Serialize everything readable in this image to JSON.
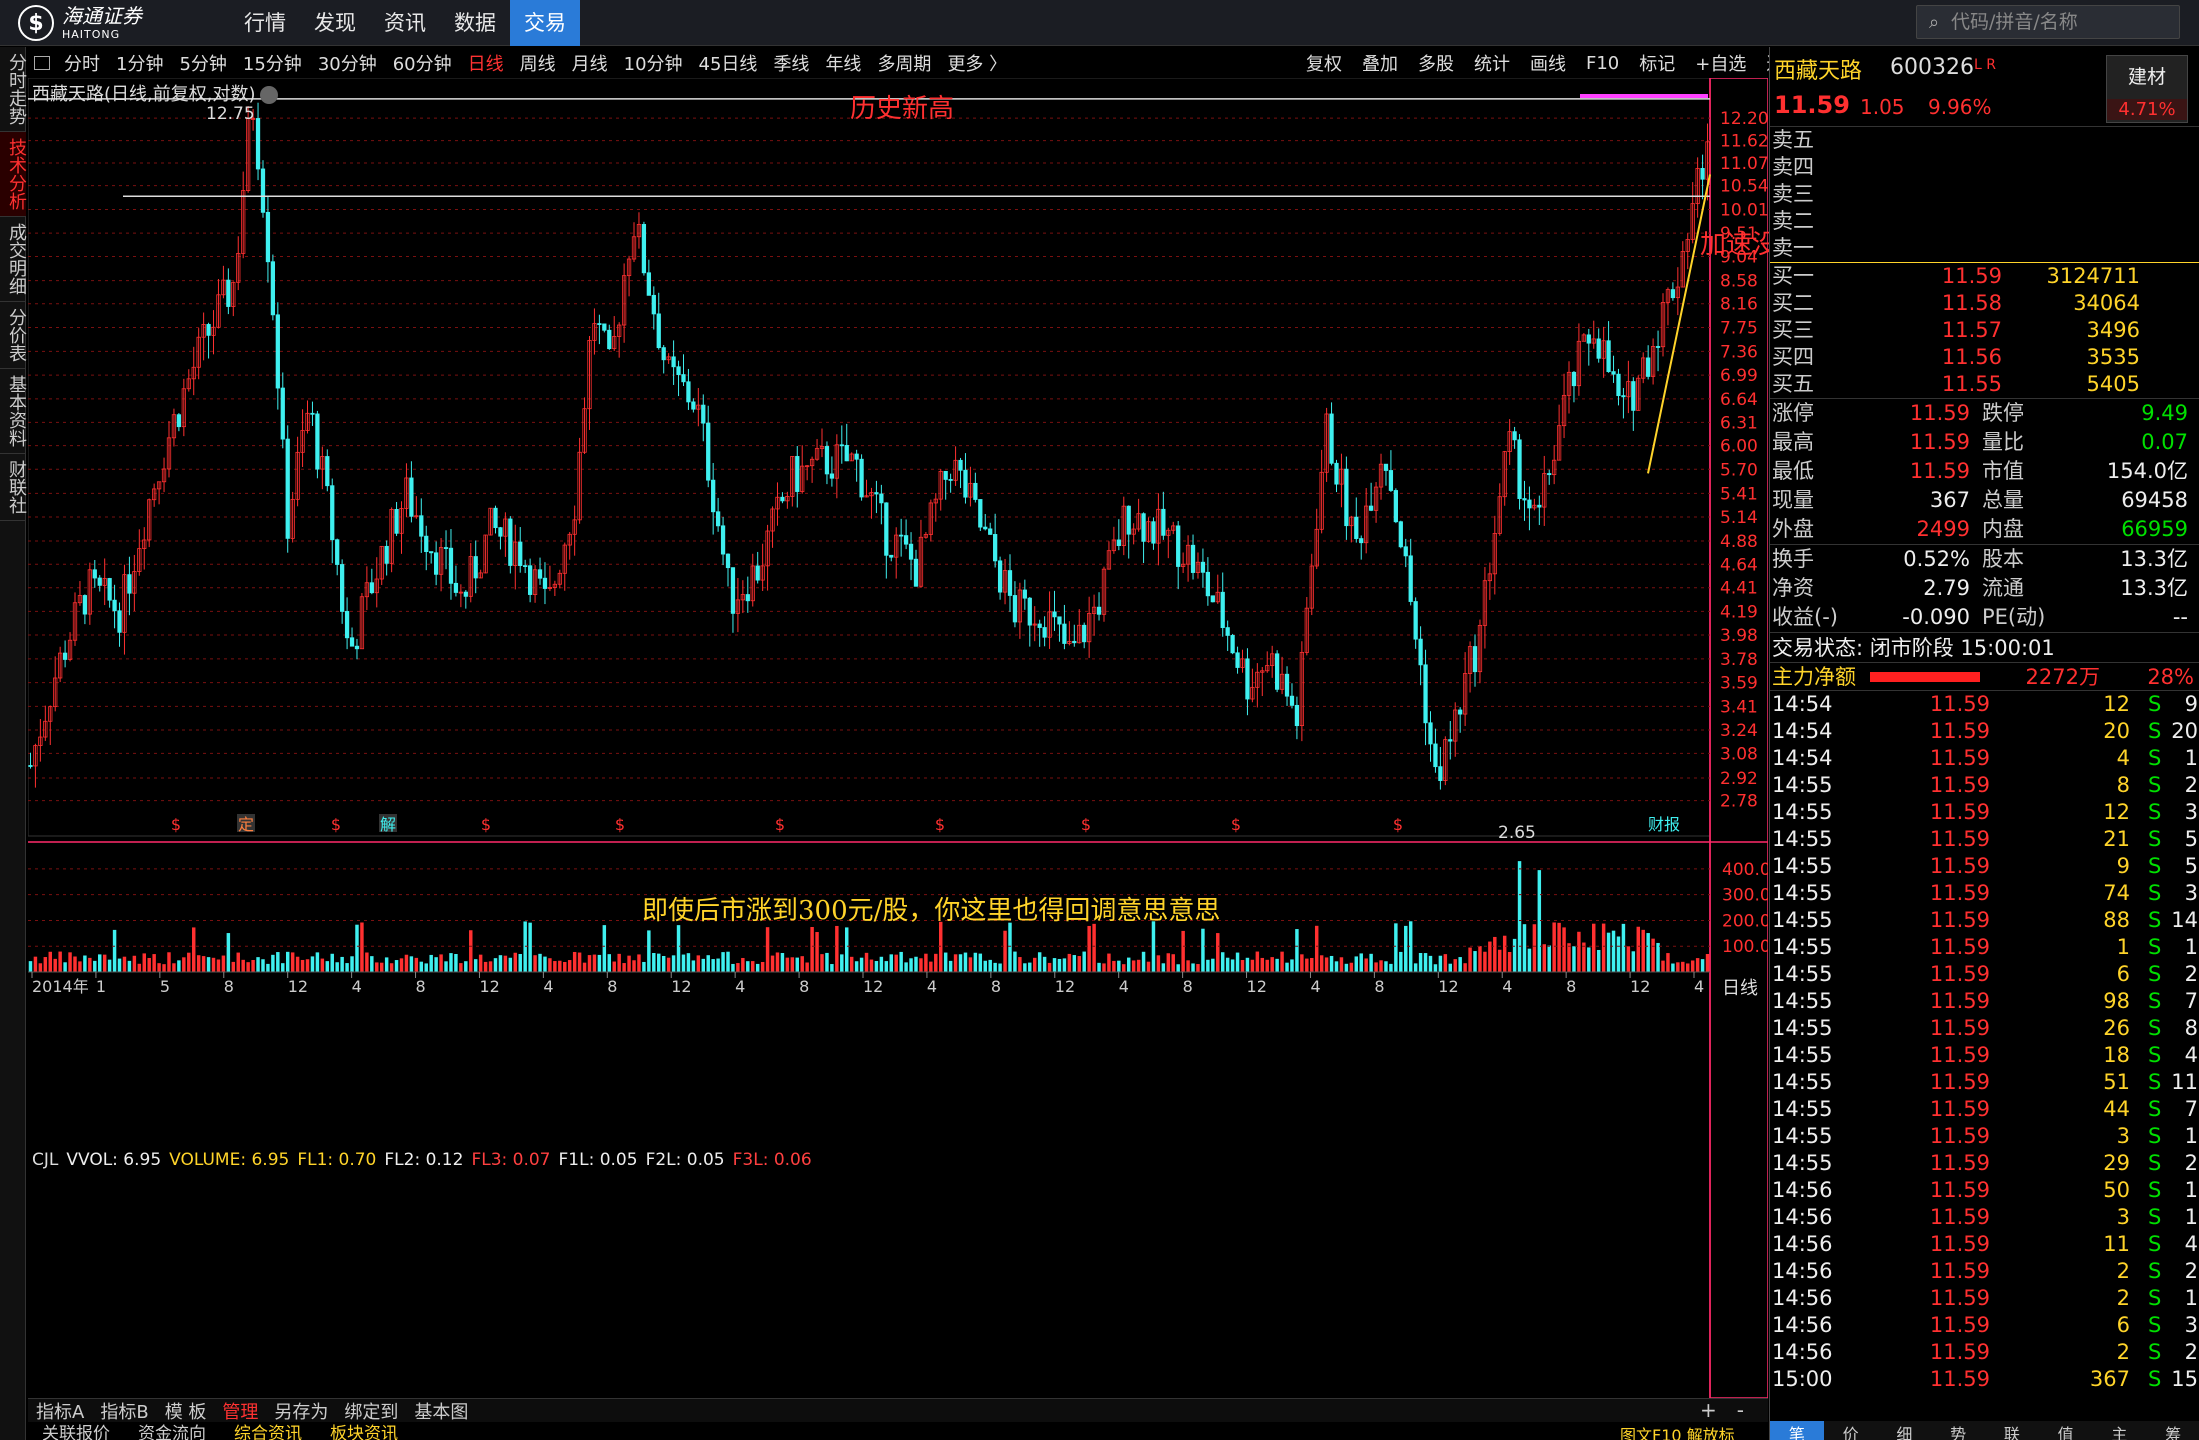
{
  "brand": {
    "cn": "海通证券",
    "en": "HAITONG"
  },
  "nav": [
    "行情",
    "发现",
    "资讯",
    "数据",
    "交易"
  ],
  "nav_active": 4,
  "search": {
    "placeholder": "代码/拼音/名称"
  },
  "left_tabs": [
    "分时走势",
    "技术分析",
    "成交明细",
    "分价表",
    "基本资料",
    "财联社"
  ],
  "left_tab_active": 1,
  "periods": [
    "分时",
    "1分钟",
    "5分钟",
    "15分钟",
    "30分钟",
    "60分钟",
    "日线",
    "周线",
    "月线",
    "10分钟",
    "45日线",
    "季线",
    "年线",
    "多周期",
    "更多 〉"
  ],
  "period_active": 6,
  "toolbar_right": [
    "复权",
    "叠加",
    "多股",
    "统计",
    "画线",
    "F10",
    "标记",
    "+自选",
    "返回"
  ],
  "chart": {
    "title": "西藏天路(日线,前复权,对数)",
    "annotation_high": "历史新高",
    "annotation_accel": "加速没有？",
    "annotation_mid": "即使后市涨到300元/股，你这里也得回调意思意思",
    "high_label": "12.75",
    "low_label": "2.65",
    "price_axis": [
      "12.20",
      "11.62",
      "11.07",
      "10.54",
      "10.01",
      "9.51",
      "9.04",
      "8.58",
      "8.16",
      "7.75",
      "7.36",
      "6.99",
      "6.64",
      "6.31",
      "6.00",
      "5.70",
      "5.41",
      "5.14",
      "4.88",
      "4.64",
      "4.41",
      "4.19",
      "3.98",
      "3.78",
      "3.59",
      "3.41",
      "3.24",
      "3.08",
      "2.92",
      "2.78"
    ],
    "x_axis": [
      "2014年",
      "1",
      "5",
      "8",
      "12",
      "4",
      "8",
      "12",
      "4",
      "8",
      "12",
      "4",
      "8",
      "12",
      "4",
      "8",
      "12",
      "4",
      "8",
      "12",
      "4",
      "8",
      "12",
      "4",
      "8",
      "12",
      "4"
    ],
    "event_markers": [
      "$",
      "定",
      "$",
      "解",
      "$",
      "$",
      "$",
      "$",
      "$",
      "$",
      "$"
    ],
    "event_tag_right": "财报",
    "period_tag": "日线"
  },
  "volume": {
    "legend": [
      {
        "k": "CJL",
        "c": "#dddddd"
      },
      {
        "k": "VVOL: 6.95",
        "c": "#eeeeee"
      },
      {
        "k": "VOLUME: 6.95",
        "c": "#ffd42a"
      },
      {
        "k": "FL1: 0.70",
        "c": "#ffd42a"
      },
      {
        "k": "FL2: 0.12",
        "c": "#eeeeee"
      },
      {
        "k": "FL3: 0.07",
        "c": "#ff4040"
      },
      {
        "k": "F1L: 0.05",
        "c": "#eeeeee"
      },
      {
        "k": "F2L: 0.05",
        "c": "#eeeeee"
      },
      {
        "k": "F3L: 0.06",
        "c": "#ff4040"
      }
    ],
    "axis": [
      "400.0",
      "300.0",
      "200.0",
      "100.0"
    ]
  },
  "bottom_tabs": [
    "指标A",
    "指标B",
    "模 板",
    "管理",
    "另存为",
    "绑定到",
    "基本图"
  ],
  "bottom_tab_active": 3,
  "bottom_tabs2": [
    "关联报价",
    "资金流向",
    "综合资讯",
    "板块资讯"
  ],
  "bottom_right": "图文F10 解放标",
  "zoom": [
    "+",
    "-"
  ],
  "stock": {
    "name": "西藏天路",
    "code": "600326",
    "flags": "L R",
    "price": "11.59",
    "change": "1.05",
    "pct": "9.96%",
    "industry": "建材",
    "industry_pct": "4.71%"
  },
  "asks": [
    {
      "l": "卖五",
      "p": "",
      "v": ""
    },
    {
      "l": "卖四",
      "p": "",
      "v": ""
    },
    {
      "l": "卖三",
      "p": "",
      "v": ""
    },
    {
      "l": "卖二",
      "p": "",
      "v": ""
    },
    {
      "l": "卖一",
      "p": "",
      "v": ""
    }
  ],
  "bids": [
    {
      "l": "买一",
      "p": "11.59",
      "v": "3124711"
    },
    {
      "l": "买二",
      "p": "11.58",
      "v": "34064"
    },
    {
      "l": "买三",
      "p": "11.57",
      "v": "3496"
    },
    {
      "l": "买四",
      "p": "11.56",
      "v": "3535"
    },
    {
      "l": "买五",
      "p": "11.55",
      "v": "5405"
    }
  ],
  "stats": [
    {
      "l1": "涨停",
      "v1": "11.59",
      "c1": "red",
      "l2": "跌停",
      "v2": "9.49",
      "c2": "grn"
    },
    {
      "l1": "最高",
      "v1": "11.59",
      "c1": "red",
      "l2": "量比",
      "v2": "0.07",
      "c2": "grn"
    },
    {
      "l1": "最低",
      "v1": "11.59",
      "c1": "red",
      "l2": "市值",
      "v2": "154.0亿",
      "c2": "wht"
    },
    {
      "l1": "现量",
      "v1": "367",
      "c1": "wht",
      "l2": "总量",
      "v2": "69458",
      "c2": "wht"
    },
    {
      "l1": "外盘",
      "v1": "2499",
      "c1": "red",
      "l2": "内盘",
      "v2": "66959",
      "c2": "grn"
    }
  ],
  "stats2": [
    {
      "l1": "换手",
      "v1": "0.52%",
      "c1": "wht",
      "l2": "股本",
      "v2": "13.3亿",
      "c2": "wht"
    },
    {
      "l1": "净资",
      "v1": "2.79",
      "c1": "wht",
      "l2": "流通",
      "v2": "13.3亿",
      "c2": "wht"
    },
    {
      "l1": "收益(-)",
      "v1": "-0.090",
      "c1": "wht",
      "l2": "PE(动)",
      "v2": "--",
      "c2": "wht"
    }
  ],
  "trade_state": "交易状态: 闭市阶段 15:00:01",
  "main_flow": {
    "label": "主力净额",
    "amount": "2272万",
    "pct": "28%"
  },
  "ticks": [
    {
      "t": "14:54",
      "p": "11.59",
      "v": "12",
      "n": "9"
    },
    {
      "t": "14:54",
      "p": "11.59",
      "v": "20",
      "n": "20"
    },
    {
      "t": "14:54",
      "p": "11.59",
      "v": "4",
      "n": "1"
    },
    {
      "t": "14:55",
      "p": "11.59",
      "v": "8",
      "n": "2"
    },
    {
      "t": "14:55",
      "p": "11.59",
      "v": "12",
      "n": "3"
    },
    {
      "t": "14:55",
      "p": "11.59",
      "v": "21",
      "n": "5"
    },
    {
      "t": "14:55",
      "p": "11.59",
      "v": "9",
      "n": "5"
    },
    {
      "t": "14:55",
      "p": "11.59",
      "v": "74",
      "n": "3"
    },
    {
      "t": "14:55",
      "p": "11.59",
      "v": "88",
      "n": "14"
    },
    {
      "t": "14:55",
      "p": "11.59",
      "v": "1",
      "n": "1"
    },
    {
      "t": "14:55",
      "p": "11.59",
      "v": "6",
      "n": "2"
    },
    {
      "t": "14:55",
      "p": "11.59",
      "v": "98",
      "n": "7"
    },
    {
      "t": "14:55",
      "p": "11.59",
      "v": "26",
      "n": "8"
    },
    {
      "t": "14:55",
      "p": "11.59",
      "v": "18",
      "n": "4"
    },
    {
      "t": "14:55",
      "p": "11.59",
      "v": "51",
      "n": "11"
    },
    {
      "t": "14:55",
      "p": "11.59",
      "v": "44",
      "n": "7"
    },
    {
      "t": "14:55",
      "p": "11.59",
      "v": "3",
      "n": "1"
    },
    {
      "t": "14:55",
      "p": "11.59",
      "v": "29",
      "n": "2"
    },
    {
      "t": "14:56",
      "p": "11.59",
      "v": "50",
      "n": "1"
    },
    {
      "t": "14:56",
      "p": "11.59",
      "v": "3",
      "n": "1"
    },
    {
      "t": "14:56",
      "p": "11.59",
      "v": "11",
      "n": "4"
    },
    {
      "t": "14:56",
      "p": "11.59",
      "v": "2",
      "n": "2"
    },
    {
      "t": "14:56",
      "p": "11.59",
      "v": "2",
      "n": "1"
    },
    {
      "t": "14:56",
      "p": "11.59",
      "v": "6",
      "n": "3"
    },
    {
      "t": "14:56",
      "p": "11.59",
      "v": "2",
      "n": "2"
    },
    {
      "t": "15:00",
      "p": "11.59",
      "v": "367",
      "n": "15"
    }
  ],
  "tick_side": "S",
  "rp_bottom": [
    "笔",
    "价",
    "细",
    "势",
    "联",
    "值",
    "主",
    "筹"
  ],
  "colors": {
    "up": "#ff3030",
    "down": "#3ff0f0",
    "accent": "#2a7bd8",
    "yellow": "#ffd42a"
  }
}
